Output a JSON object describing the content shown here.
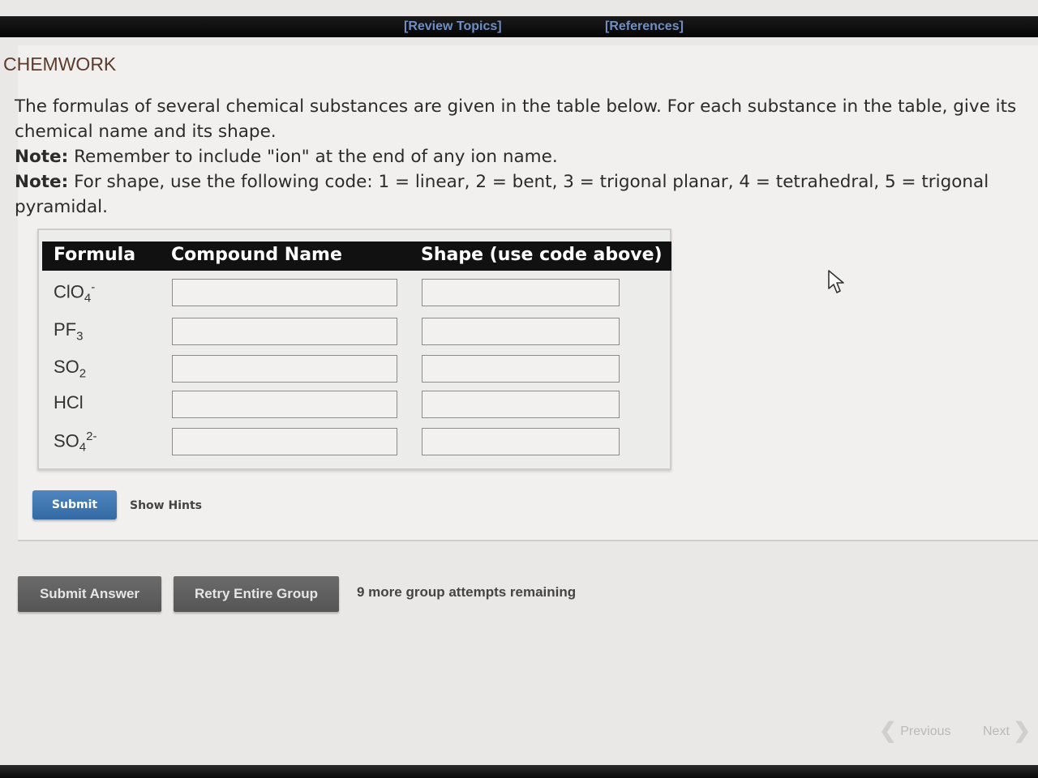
{
  "topbar": {
    "review_topics": "[Review Topics]",
    "references": "[References]"
  },
  "brand": "CHEMWORK",
  "prompt": {
    "intro": "The formulas of several chemical substances are given in the table below. For each substance in the table, give its chemical name and its shape.",
    "note_label": "Note:",
    "note1": " Remember to include \"ion\" at the end of any ion name.",
    "note2": " For shape, use the following code: 1 = linear, 2 = bent, 3 = trigonal planar, 4 = tetrahedral, 5 = trigonal pyramidal."
  },
  "table": {
    "headers": {
      "formula": "Formula",
      "name": "Compound Name",
      "shape": "Shape (use code above)"
    },
    "rows": [
      {
        "base": "ClO",
        "sub": "4",
        "sup": "-",
        "name_value": "",
        "shape_value": ""
      },
      {
        "base": "PF",
        "sub": "3",
        "sup": "",
        "name_value": "",
        "shape_value": ""
      },
      {
        "base": "SO",
        "sub": "2",
        "sup": "",
        "name_value": "",
        "shape_value": ""
      },
      {
        "base": "HCl",
        "sub": "",
        "sup": "",
        "name_value": "",
        "shape_value": ""
      },
      {
        "base": "SO",
        "sub": "4",
        "sup": "2-",
        "name_value": "",
        "shape_value": ""
      }
    ]
  },
  "actions": {
    "submit": "Submit",
    "show_hints": "Show Hints",
    "submit_answer": "Submit Answer",
    "retry_group": "Retry Entire Group",
    "attempts": "9 more group attempts remaining"
  },
  "nav": {
    "previous": "Previous",
    "next": "Next"
  },
  "colors": {
    "submit_blue": "#3f77b2",
    "header_black": "#111111",
    "link_blue": "#6f8fc4",
    "brand_brown": "#5c3a2c"
  },
  "icons": {
    "cursor": "mouse-pointer-icon",
    "prev": "chevron-left-icon",
    "next": "chevron-right-icon"
  }
}
